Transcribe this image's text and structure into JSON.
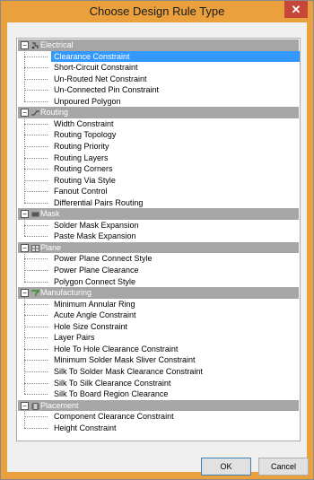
{
  "window": {
    "title": "Choose Design Rule Type",
    "close_glyph": "✕"
  },
  "categories": [
    {
      "label": "Electrical",
      "icon": "electrical-icon",
      "rules": [
        "Clearance Constraint",
        "Short-Circuit Constraint",
        "Un-Routed Net Constraint",
        "Un-Connected Pin Constraint",
        "Unpoured Polygon"
      ]
    },
    {
      "label": "Routing",
      "icon": "routing-icon",
      "rules": [
        "Width Constraint",
        "Routing Topology",
        "Routing Priority",
        "Routing Layers",
        "Routing Corners",
        "Routing Via Style",
        "Fanout Control",
        "Differential Pairs Routing"
      ]
    },
    {
      "label": "Mask",
      "icon": "mask-icon",
      "rules": [
        "Solder Mask Expansion",
        "Paste Mask Expansion"
      ]
    },
    {
      "label": "Plane",
      "icon": "plane-icon",
      "rules": [
        "Power Plane Connect Style",
        "Power Plane Clearance",
        "Polygon Connect Style"
      ]
    },
    {
      "label": "Manufacturing",
      "icon": "manufacturing-icon",
      "rules": [
        "Minimum Annular Ring",
        "Acute Angle Constraint",
        "Hole Size Constraint",
        "Layer Pairs",
        "Hole To Hole Clearance Constraint",
        "Minimum Solder Mask Sliver Constraint",
        "Silk To Solder Mask Clearance Constraint",
        "Silk To Silk Clearance Constraint",
        "Silk To Board Region Clearance"
      ]
    },
    {
      "label": "Placement",
      "icon": "placement-icon",
      "rules": [
        "Component Clearance Constraint",
        "Height Constraint"
      ]
    }
  ],
  "selected_rule": "Clearance Constraint",
  "expander_glyph": "−",
  "buttons": {
    "ok": "OK",
    "cancel": "Cancel"
  },
  "colors": {
    "titlebar": "#eaa03c",
    "category_bar": "#a6a6a6",
    "selection": "#3399ff",
    "close_button": "#c7463a"
  }
}
